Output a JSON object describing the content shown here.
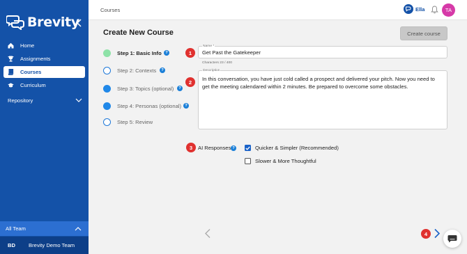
{
  "app": {
    "name": "Brevity"
  },
  "sidebar": {
    "items": [
      {
        "label": "Home",
        "icon": "home-icon",
        "active": false
      },
      {
        "label": "Assignments",
        "icon": "trophy-icon",
        "active": false
      },
      {
        "label": "Courses",
        "icon": "book-icon",
        "active": true
      },
      {
        "label": "Curriculum",
        "icon": "graduation-cap-icon",
        "active": false
      }
    ],
    "repository": "Repository",
    "team_header": "All Team",
    "team": {
      "abbr": "BD",
      "name": "Brevity Demo Team"
    }
  },
  "topbar": {
    "breadcrumb": "Courses",
    "user_name": "Ella",
    "avatar_initials": "TA"
  },
  "page": {
    "title": "Create New Course",
    "create_button": "Create course"
  },
  "steps": [
    {
      "label": "Step 1: Basic Info",
      "status": "done",
      "active": true
    },
    {
      "label": "Step 2: Contexts",
      "status": "empty",
      "active": false
    },
    {
      "label": "Step 3: Topics (optional)",
      "status": "filled",
      "active": false
    },
    {
      "label": "Step 4: Personas (optional)",
      "status": "filled",
      "active": false
    },
    {
      "label": "Step 5: Review",
      "status": "empty",
      "active": false
    }
  ],
  "form": {
    "name_label": "Name *",
    "name_value": "Get Past the Gatekeeper",
    "char_count": "Characters 23 / 400",
    "description_label": "Description",
    "description_value": "In this conversation, you have just cold called a prospect and delivered your pitch. Now you need to get the meeting calendared within 2 minutes. Be prepared to overcome some obstacles.",
    "ai_label": "AI Responses",
    "option_fast": "Quicker & Simpler (Recommended)",
    "option_slow": "Slower & More Thoughtful",
    "option_fast_checked": true,
    "option_slow_checked": false
  },
  "badges": [
    "1",
    "2",
    "3",
    "4"
  ],
  "help_glyph": "?",
  "colors": {
    "sidebar": "#1452a8",
    "accent": "#1a7fd8",
    "badge": "#e0312f",
    "step_done": "#8ee2a8",
    "avatar": "#d63aa8"
  }
}
